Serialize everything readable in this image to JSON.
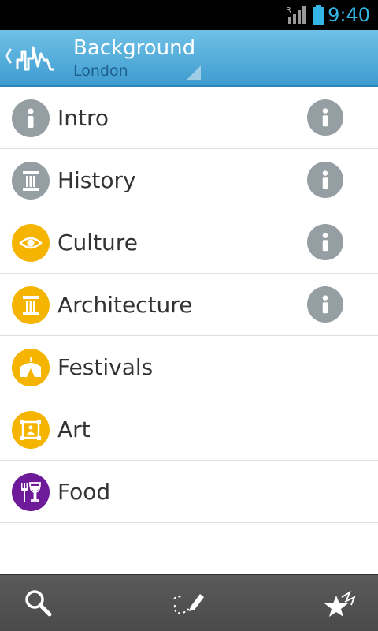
{
  "status_bar": {
    "time": "9:40",
    "time_color": "#33b5e5",
    "signal_icon": "signal-roaming-icon",
    "battery_icon": "battery-icon"
  },
  "action_bar": {
    "title": "Background",
    "subtitle": "London",
    "logo_icon": "city-skyline-logo-icon",
    "background_color": "#3f9cd0"
  },
  "list": {
    "items": [
      {
        "label": "Intro",
        "icon": "info-icon",
        "color": "#959ea3",
        "has_info": true
      },
      {
        "label": "History",
        "icon": "column-icon",
        "color": "#959ea3",
        "has_info": true
      },
      {
        "label": "Culture",
        "icon": "eye-icon",
        "color": "#f4b400",
        "has_info": true
      },
      {
        "label": "Architecture",
        "icon": "column-icon",
        "color": "#f4b400",
        "has_info": true
      },
      {
        "label": "Festivals",
        "icon": "tent-icon",
        "color": "#f4b400",
        "has_info": false
      },
      {
        "label": "Art",
        "icon": "picture-frame-icon",
        "color": "#f4b400",
        "has_info": false
      },
      {
        "label": "Food",
        "icon": "fork-wine-icon",
        "color": "#6d1b99",
        "has_info": false
      }
    ]
  },
  "bottom_bar": {
    "buttons": [
      {
        "icon": "search-icon"
      },
      {
        "icon": "itinerary-edit-icon"
      },
      {
        "icon": "favorites-stars-icon"
      }
    ]
  }
}
